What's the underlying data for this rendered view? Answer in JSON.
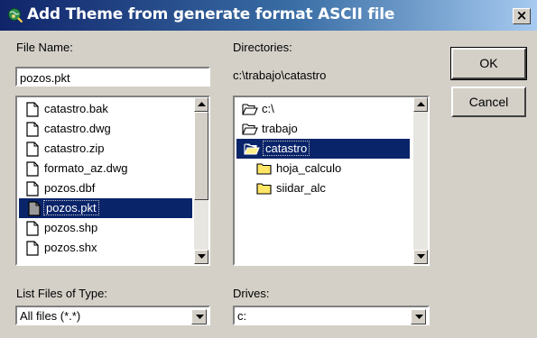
{
  "window": {
    "title": "Add Theme from generate format ASCII file",
    "close_label": "×"
  },
  "file_name": {
    "label": "File Name:",
    "value": "pozos.pkt"
  },
  "files": [
    {
      "name": "catastro.bak",
      "selected": false
    },
    {
      "name": "catastro.dwg",
      "selected": false
    },
    {
      "name": "catastro.zip",
      "selected": false
    },
    {
      "name": "formato_az.dwg",
      "selected": false
    },
    {
      "name": "pozos.dbf",
      "selected": false
    },
    {
      "name": "pozos.pkt",
      "selected": true
    },
    {
      "name": "pozos.shp",
      "selected": false
    },
    {
      "name": "pozos.shx",
      "selected": false
    }
  ],
  "directories": {
    "label": "Directories:",
    "current_path": "c:\\trabajo\\catastro"
  },
  "dir_items": [
    {
      "name": "c:\\",
      "state": "open",
      "level": 0,
      "selected": false
    },
    {
      "name": "trabajo",
      "state": "open",
      "level": 0,
      "selected": false
    },
    {
      "name": "catastro",
      "state": "open",
      "level": 0,
      "selected": true
    },
    {
      "name": "hoja_calculo",
      "state": "closed",
      "level": 1,
      "selected": false
    },
    {
      "name": "siidar_alc",
      "state": "closed",
      "level": 1,
      "selected": false
    }
  ],
  "buttons": {
    "ok": "OK",
    "cancel": "Cancel"
  },
  "file_type": {
    "label": "List Files of Type:",
    "value": "All files (*.*)"
  },
  "drives": {
    "label": "Drives:",
    "value": "c:"
  },
  "colors": {
    "title_start": "#10246a",
    "selection": "#0a246a",
    "dialog_bg": "#d4d0c8"
  }
}
